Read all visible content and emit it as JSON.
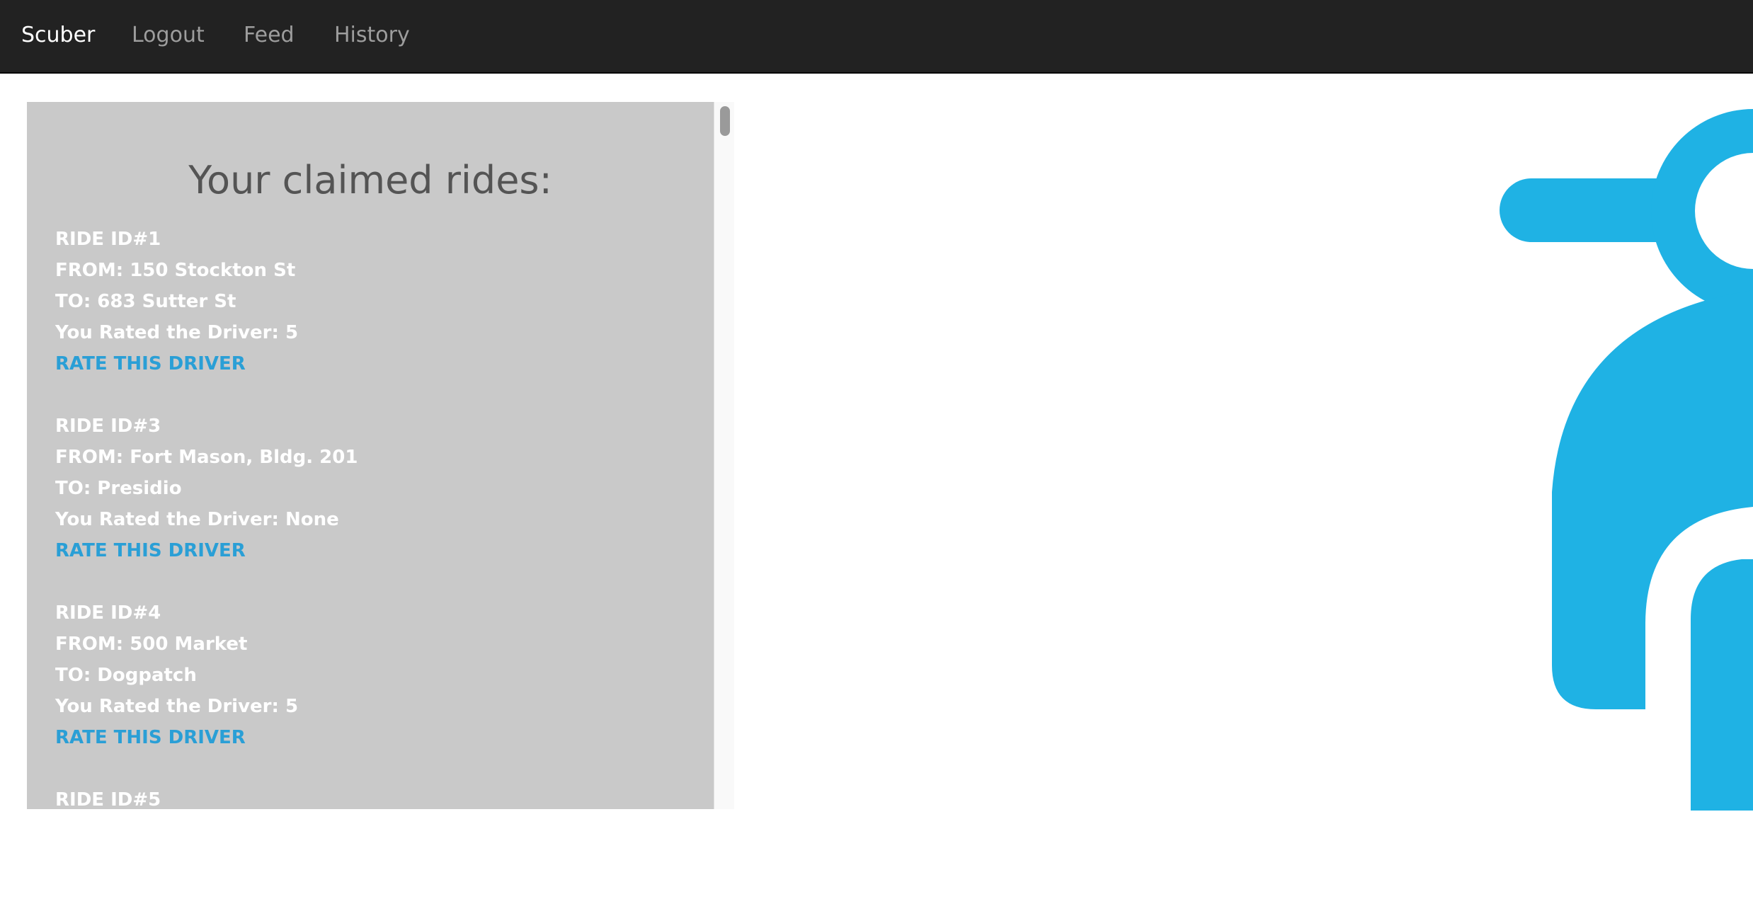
{
  "navbar": {
    "brand": "Scuber",
    "links": [
      "Logout",
      "Feed",
      "History"
    ]
  },
  "panel": {
    "title": "Your claimed rides:",
    "rides": [
      {
        "id_text": "RIDE ID#1",
        "from_text": "FROM: 150 Stockton St",
        "to_text": "TO: 683 Sutter St",
        "rating_text": "You Rated the Driver: 5",
        "action_label": "RATE THIS DRIVER"
      },
      {
        "id_text": "RIDE ID#3",
        "from_text": "FROM: Fort Mason, Bldg. 201",
        "to_text": "TO: Presidio",
        "rating_text": "You Rated the Driver: None",
        "action_label": "RATE THIS DRIVER"
      },
      {
        "id_text": "RIDE ID#4",
        "from_text": "FROM: 500 Market",
        "to_text": "TO: Dogpatch",
        "rating_text": "You Rated the Driver: 5",
        "action_label": "RATE THIS DRIVER"
      },
      {
        "id_text": "RIDE ID#5"
      }
    ]
  },
  "colors": {
    "navbar_bg": "#222222",
    "panel_bg": "#c9c9c9",
    "link_blue": "#2a9fd6",
    "logo_blue": "#1fb2e4"
  },
  "icons": {
    "logo": "scooter-icon"
  }
}
